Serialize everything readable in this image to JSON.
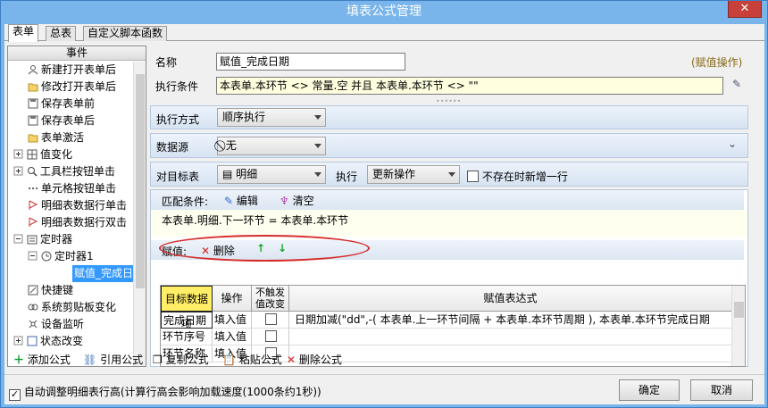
{
  "window": {
    "title": "填表公式管理",
    "close": "✕"
  },
  "tabs": [
    "表单",
    "总表",
    "自定义脚本函数"
  ],
  "left": {
    "header": "事件",
    "tree": [
      "新建打开表单后",
      "修改打开表单后",
      "保存表单前",
      "保存表单后",
      "表单激活",
      "值变化",
      "工具栏按钮单击",
      "单元格按钮单击",
      "明细表数据行单击",
      "明细表数据行双击",
      "定时器",
      "定时器1",
      "赋值_完成日",
      "快捷键",
      "系统剪贴板变化",
      "设备监听",
      "状态改变"
    ]
  },
  "form": {
    "name_label": "名称",
    "name_value": "赋值_完成日期",
    "assign_op": "(赋值操作)",
    "cond_label": "执行条件",
    "cond_value": "本表单.本环节 <> 常量.空 并且 本表单.本环节 <> \"\"",
    "mode_label": "执行方式",
    "mode_value": "顺序执行",
    "source_label": "数据源",
    "source_value": "无",
    "target_label": "对目标表",
    "target_value": "明细",
    "exec_label": "执行",
    "exec_value": "更新操作",
    "newrow_label": "不存在时新增一行",
    "match_label": "匹配条件:",
    "edit_label": "编辑",
    "clear_label": "清空",
    "match_expr": "本表单.明细.下一环节  =  本表单.本环节",
    "assign_label": "赋值:",
    "delete_label": "删除"
  },
  "grid": {
    "headers": [
      "目标数据项",
      "操作",
      "不触发值改变",
      "赋值表达式"
    ],
    "rows": [
      {
        "target": "完成日期",
        "op": "填入值",
        "expr": "日期加减(\"dd\",-(  本表单.上一环节间隔  + 本表单.本环节周期 ), 本表单.本环节完成日期"
      },
      {
        "target": "环节序号",
        "op": "填入值",
        "expr": ""
      },
      {
        "target": "环节名称",
        "op": "填入值",
        "expr": ""
      }
    ]
  },
  "toolbar": {
    "add": "添加公式",
    "ref": "引用公式",
    "copy": "复制公式",
    "paste": "粘贴公式",
    "del": "删除公式"
  },
  "footer": {
    "auto_height": "自动调整明细表行高(计算行高会影响加载速度(1000条约1秒))",
    "ok": "确定",
    "cancel": "取消"
  }
}
